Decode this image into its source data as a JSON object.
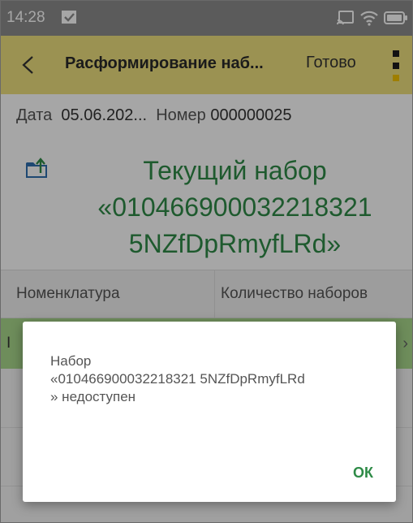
{
  "status_bar": {
    "time": "14:28",
    "icons": [
      "check-square-icon",
      "cast-icon",
      "wifi-icon",
      "battery-icon"
    ],
    "background": "#8d8d8d"
  },
  "app_bar": {
    "title": "Расформирование наб...",
    "done_label": "Готово",
    "background": "#efe07f",
    "accent": "#f5c400"
  },
  "header": {
    "date_label": "Дата",
    "date_value": "05.06.202...",
    "number_label": "Номер",
    "number_value": "000000025"
  },
  "current_set": {
    "text": "Текущий набор «010466900032218321 5NZfDpRmyfLRd»",
    "color": "#2e8b47"
  },
  "table": {
    "columns": [
      "Номенклатура",
      "Количество наборов"
    ],
    "row_text": "I",
    "row_background": "#a9d98c"
  },
  "dialog": {
    "message": "Набор\n«010466900032218321 5NZfDpRmyfLRd\n» недоступен",
    "ok_label": "ОК"
  }
}
